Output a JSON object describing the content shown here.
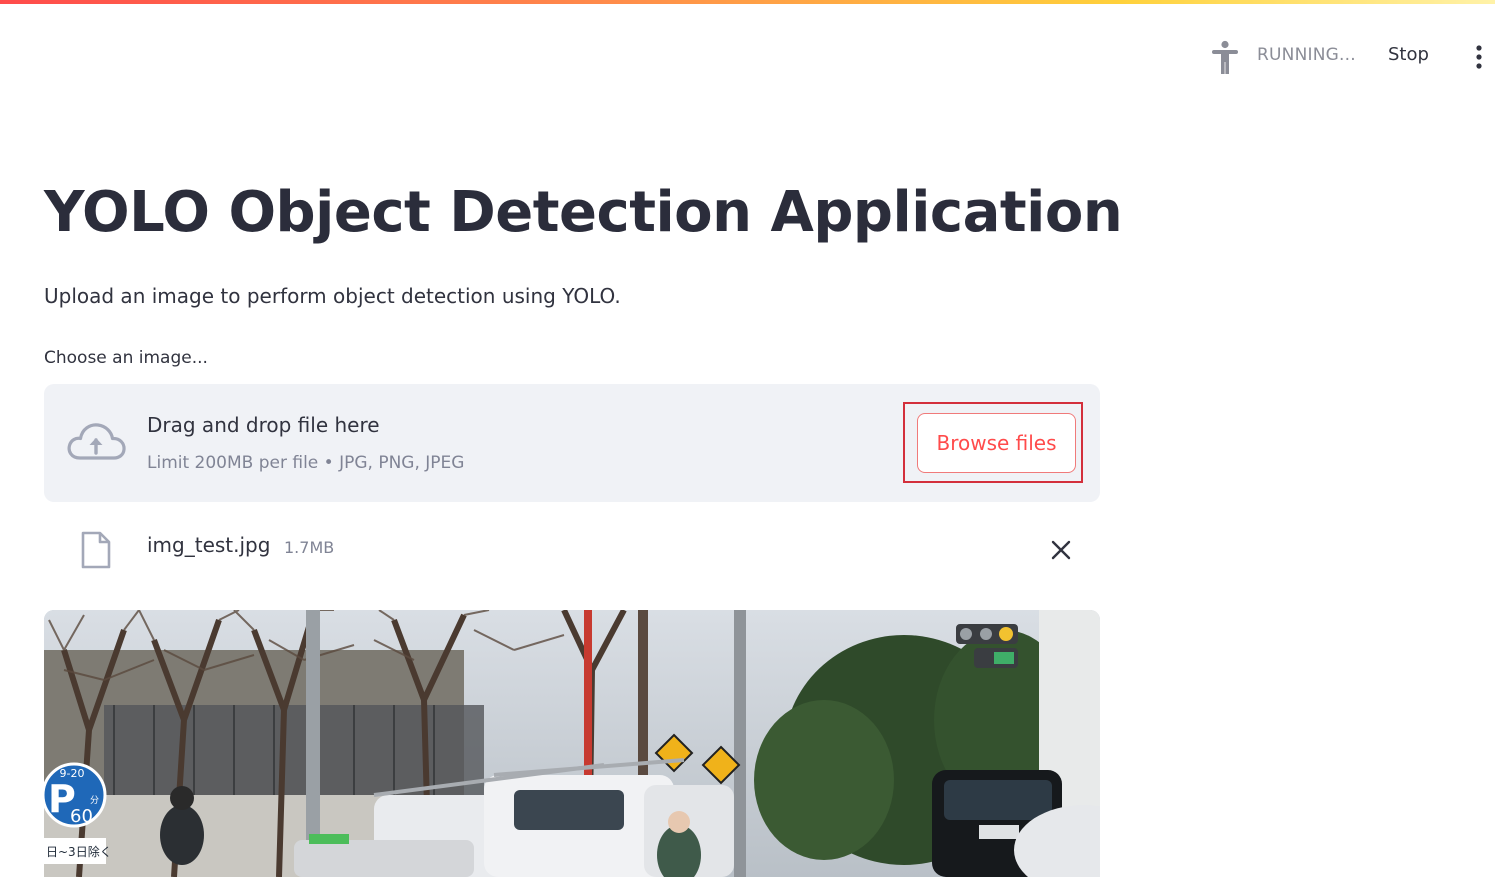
{
  "header": {
    "status_text": "RUNNING...",
    "stop_label": "Stop",
    "icons": {
      "running": "running-man-icon",
      "menu": "vertical-dots-menu-icon"
    }
  },
  "main": {
    "title": "YOLO Object Detection Application",
    "subtitle": "Upload an image to perform object detection using YOLO.",
    "uploader": {
      "label": "Choose an image...",
      "drop_title": "Drag and drop file here",
      "limit_text": "Limit 200MB per file • JPG, PNG, JPEG",
      "browse_label": "Browse files",
      "icon": "cloud-upload-icon"
    },
    "uploaded_file": {
      "name": "img_test.jpg",
      "size": "1.7MB",
      "icon": "file-icon",
      "remove_icon": "close-icon"
    },
    "image": {
      "sign_top": "9-20",
      "sign_letter": "P",
      "sign_number": "60",
      "sign_small": "分",
      "sign_plate": "日~3日除く"
    }
  },
  "colors": {
    "accent": "#ff4b4b",
    "highlight_box": "#d32f3b",
    "dropzone_bg": "#f0f2f6",
    "text": "#31333f",
    "muted": "#808495"
  }
}
